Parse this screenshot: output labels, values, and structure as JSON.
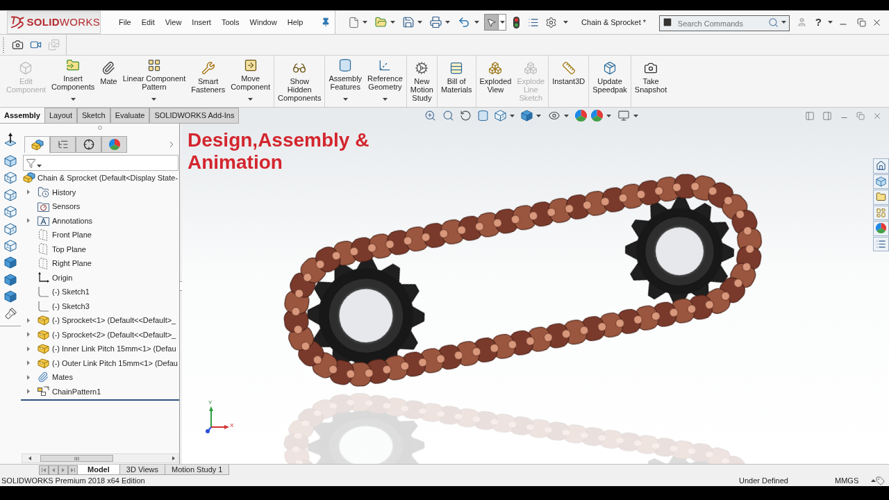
{
  "title_bar": {
    "logo": "**SOLID**WORKS",
    "menu": [
      "File",
      "Edit",
      "View",
      "Insert",
      "Tools",
      "Window",
      "Help"
    ],
    "document_title": "Chain & Sprocket *",
    "search": {
      "placeholder": "Search Commands"
    },
    "help": "?"
  },
  "quick_access": {
    "select_tool": {
      "selected": true
    }
  },
  "capture_toolbar": [
    {
      "disabled": false
    },
    {
      "disabled": false
    },
    {
      "disabled": true
    }
  ],
  "command_manager": {
    "groups": [
      {
        "buttons": [
          {
            "label": "Edit\nComponent",
            "dropdown": false,
            "disabled": true
          },
          {
            "label": "Insert\nComponents",
            "dropdown": true,
            "disabled": false
          },
          {
            "label": "Mate",
            "dropdown": false,
            "disabled": false
          },
          {
            "label": "Linear Component\nPattern",
            "dropdown": true,
            "disabled": false
          },
          {
            "label": "Smart\nFasteners",
            "dropdown": false,
            "disabled": false
          },
          {
            "label": "Move\nComponent",
            "dropdown": true,
            "disabled": false
          }
        ]
      },
      {
        "buttons": [
          {
            "label": "Show\nHidden\nComponents",
            "dropdown": false,
            "disabled": false
          }
        ]
      },
      {
        "buttons": [
          {
            "label": "Assembly\nFeatures",
            "dropdown": true,
            "disabled": false
          },
          {
            "label": "Reference\nGeometry",
            "dropdown": true,
            "disabled": false
          }
        ]
      },
      {
        "buttons": [
          {
            "label": "New\nMotion\nStudy",
            "dropdown": false,
            "disabled": false
          }
        ]
      },
      {
        "buttons": [
          {
            "label": "Bill of\nMaterials",
            "dropdown": false,
            "disabled": false
          }
        ]
      },
      {
        "buttons": [
          {
            "label": "Exploded\nView",
            "dropdown": false,
            "disabled": false
          },
          {
            "label": "Explode\nLine\nSketch",
            "dropdown": false,
            "disabled": true
          }
        ]
      },
      {
        "buttons": [
          {
            "label": "Instant3D",
            "dropdown": false,
            "disabled": false
          }
        ]
      },
      {
        "buttons": [
          {
            "label": "Update\nSpeedpak",
            "dropdown": false,
            "disabled": false
          }
        ]
      },
      {
        "buttons": [
          {
            "label": "Take\nSnapshot",
            "dropdown": false,
            "disabled": false
          }
        ]
      }
    ]
  },
  "command_tabs": [
    {
      "label": "Assembly",
      "selected": true
    },
    {
      "label": "Layout",
      "selected": false
    },
    {
      "label": "Sketch",
      "selected": false
    },
    {
      "label": "Evaluate",
      "selected": false
    },
    {
      "label": "SOLIDWORKS Add-Ins",
      "selected": false
    }
  ],
  "feature_manager": {
    "tabs": [
      {
        "selected": true
      },
      {
        "selected": false
      },
      {
        "selected": false
      },
      {
        "selected": false
      }
    ],
    "tree": {
      "label": "Chain & Sprocket (Default<Display State-",
      "kind": "assembly",
      "children": [
        {
          "label": "History",
          "kind": "history",
          "expandable": true
        },
        {
          "label": "Sensors",
          "kind": "sensors",
          "expandable": false
        },
        {
          "label": "Annotations",
          "kind": "annotations",
          "expandable": true
        },
        {
          "label": "Front Plane",
          "kind": "plane",
          "expandable": false
        },
        {
          "label": "Top Plane",
          "kind": "plane",
          "expandable": false
        },
        {
          "label": "Right Plane",
          "kind": "plane",
          "expandable": false
        },
        {
          "label": "Origin",
          "kind": "origin",
          "expandable": false
        },
        {
          "label": "(-) Sketch1",
          "kind": "sketch",
          "expandable": false
        },
        {
          "label": "(-) Sketch3",
          "kind": "sketch",
          "expandable": false
        },
        {
          "label": "(-) Sprocket<1> (Default<<Default>_",
          "kind": "part",
          "expandable": true
        },
        {
          "label": "(-) Sprocket<2> (Default<<Default>_",
          "kind": "part",
          "expandable": true
        },
        {
          "label": "(-) Inner Link Pitch 15mm<1> (Defau",
          "kind": "part",
          "expandable": true
        },
        {
          "label": "(-) Outer Link Pitch 15mm<1> (Defau",
          "kind": "part",
          "expandable": true
        },
        {
          "label": "Mates",
          "kind": "mates",
          "expandable": true
        },
        {
          "label": "ChainPattern1",
          "kind": "pattern",
          "expandable": true
        }
      ]
    }
  },
  "graphics_area": {
    "heading": "Design,Assembly & Animation",
    "triad": {
      "x_label": "X",
      "y_label": "Y"
    }
  },
  "sheet_tabs": [
    {
      "label": "Model",
      "selected": true
    },
    {
      "label": "3D Views",
      "selected": false
    },
    {
      "label": "Motion Study 1",
      "selected": false
    }
  ],
  "status_bar": {
    "edition": "SOLIDWORKS Premium 2018 x64 Edition",
    "state": "Under Defined",
    "units": "MMGS"
  }
}
